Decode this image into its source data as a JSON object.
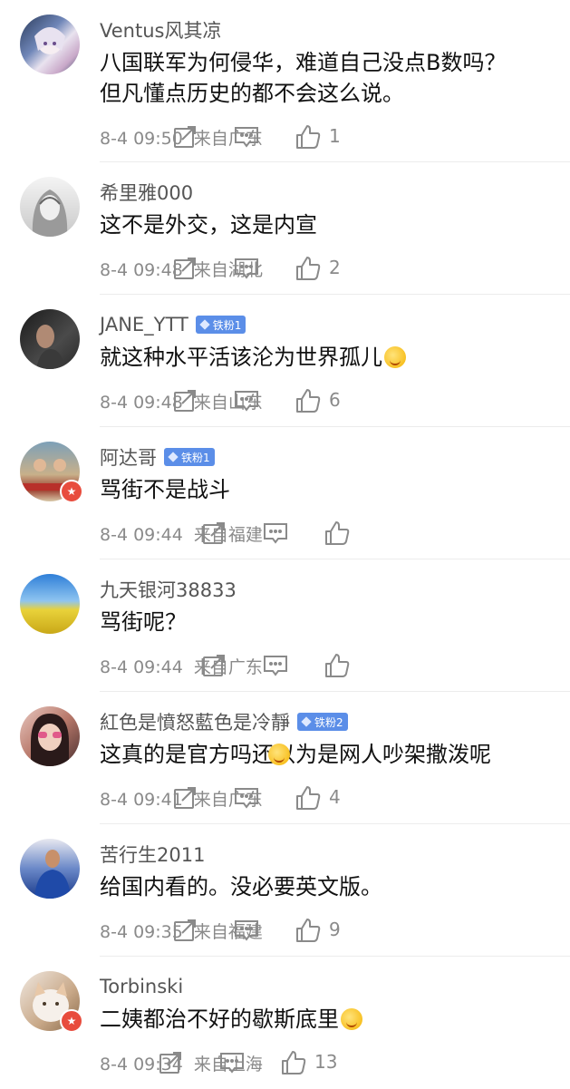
{
  "colors": {
    "username": "#555555",
    "content": "#111111",
    "meta": "#8a8a8a",
    "fan_badge": "#5b8ee8",
    "divider": "#ececec",
    "icon_stroke": "#8a8a8a"
  },
  "comments": [
    {
      "username": "Ventus风其凉",
      "fan_badge": "",
      "content": "八国联军为何侵华，难道自己没点B数吗？\n但凡懂点历史的都不会这么说。",
      "time": "8-4 09:50",
      "location": "来自广东",
      "likes": "1",
      "emoji": "",
      "avatar_icon": "anime-avatar"
    },
    {
      "username": "希里雅000",
      "fan_badge": "",
      "content": "这不是外交，这是内宣",
      "time": "8-4 09:48",
      "location": "来自湖北",
      "likes": "2",
      "emoji": "",
      "avatar_icon": "sketch-portrait-avatar"
    },
    {
      "username": "JANE_YTT",
      "fan_badge": "铁粉1",
      "content": "就这种水平活该沦为世界孤儿",
      "time": "8-4 09:48",
      "location": "来自山东",
      "likes": "6",
      "emoji": "laugh-cry-emoji",
      "avatar_icon": "dark-portrait-avatar"
    },
    {
      "username": "阿达哥",
      "fan_badge": "铁粉1",
      "content": "骂街不是战斗",
      "time": "8-4 09:44",
      "location": "来自福建",
      "likes": "",
      "emoji": "",
      "avatar_icon": "poster-avatar"
    },
    {
      "username": "九天银河38833",
      "fan_badge": "",
      "content": "骂街呢？",
      "time": "8-4 09:44",
      "location": "来自广东",
      "likes": "",
      "emoji": "",
      "avatar_icon": "landscape-avatar"
    },
    {
      "username": "紅色是憤怒藍色是冷靜",
      "fan_badge": "铁粉2",
      "content": "这真的是官方吗还以为是网人吵架撒泼呢",
      "time": "8-4 09:41",
      "location": "来自广东",
      "likes": "4",
      "emoji": "sweat-smile-emoji",
      "avatar_icon": "girl-avatar"
    },
    {
      "username": "苦行生2011",
      "fan_badge": "",
      "content": "给国内看的。没必要英文版。",
      "time": "8-4 09:35",
      "location": "来自福建",
      "likes": "9",
      "emoji": "",
      "avatar_icon": "football-player-avatar"
    },
    {
      "username": "Torbinski",
      "fan_badge": "",
      "content": "二姨都治不好的歇斯底里",
      "time": "8-4 09:34",
      "location": "来自上海",
      "likes": "13",
      "emoji": "kiss-emoji",
      "avatar_icon": "cat-avatar"
    }
  ]
}
